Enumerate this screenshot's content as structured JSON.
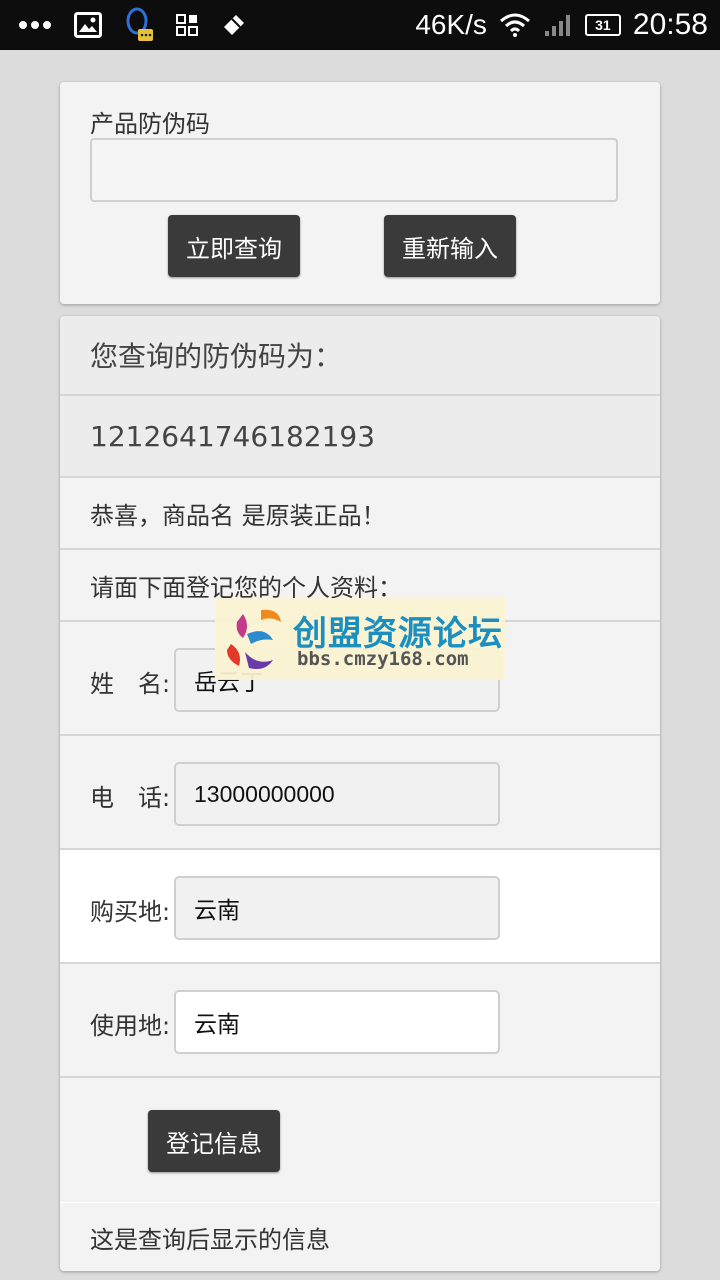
{
  "status_bar": {
    "net_speed": "46K/s",
    "battery": "31",
    "time": "20:58"
  },
  "query": {
    "label": "产品防伪码",
    "code_value": "",
    "query_button": "立即查询",
    "reset_button": "重新输入"
  },
  "result": {
    "heading": "您查询的防伪码为：",
    "code": "1212641746182193",
    "message": "恭喜，商品名 是原装正品！",
    "register_prompt": "请面下面登记您的个人资料：",
    "name_label": "姓　名:",
    "name_value": "岳云丁",
    "phone_label": "电　话:",
    "phone_value": "13000000000",
    "purchase_label": "购买地:",
    "purchase_value": "云南",
    "use_label": "使用地:",
    "use_value": "云南",
    "register_button": "登记信息",
    "footer_note": "这是查询后显示的信息"
  },
  "watermark": {
    "title": "创盟资源论坛",
    "url": "bbs.cmzy168.com"
  }
}
